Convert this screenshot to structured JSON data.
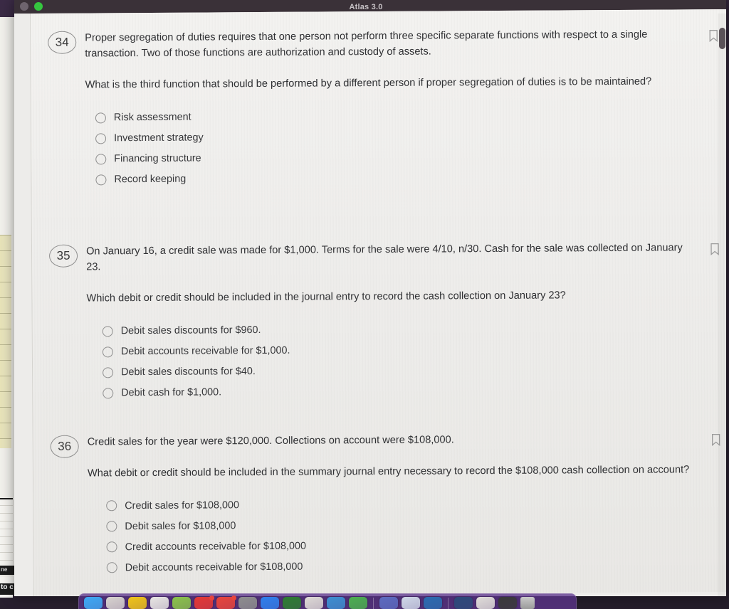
{
  "window": {
    "title": "Atlas 3.0",
    "traffic_lights": [
      "close-red",
      "minimize-gray",
      "zoom-green"
    ]
  },
  "icons": {
    "bookmark": "bookmark-icon",
    "radio": "radio-unselected-icon",
    "trash": "trash-icon"
  },
  "colors": {
    "titlebar": "#3a3138",
    "sheet": "#f0efed",
    "text": "#2f3033",
    "dock": "#5c348c",
    "close": "#e6463c",
    "minimize": "#6e646e",
    "zoom": "#35c63f"
  },
  "background_fragments": {
    "line1": "ne",
    "line2": "to c"
  },
  "questions": [
    {
      "number": "34",
      "stem": "Proper segregation of duties requires that one person not perform three specific separate functions with respect to a single transaction. Two of those functions are authorization and custody of assets.",
      "prompt": "What is the third function that should be performed by a different person if proper segregation of duties is to be maintained?",
      "bookmarked": false,
      "options": [
        "Risk assessment",
        "Investment strategy",
        "Financing structure",
        "Record keeping"
      ]
    },
    {
      "number": "35",
      "stem": "On January 16, a credit sale was made for $1,000. Terms for the sale were 4/10, n/30. Cash for the sale was collected on January 23.",
      "prompt": "Which debit or credit should be included in the journal entry to record the cash collection on January 23?",
      "bookmarked": false,
      "options": [
        "Debit sales discounts for $960.",
        "Debit accounts receivable for $1,000.",
        "Debit sales discounts for $40.",
        "Debit cash for $1,000."
      ]
    },
    {
      "number": "36",
      "stem": "Credit sales for the year were $120,000. Collections on account were $108,000.",
      "prompt": "What debit or credit should be included in the summary journal entry necessary to record the $108,000 cash collection on account?",
      "bookmarked": false,
      "options": [
        "Credit sales for $108,000",
        "Debit sales for $108,000",
        "Credit accounts receivable for $108,000",
        "Debit accounts receivable for $108,000"
      ]
    }
  ],
  "dock": {
    "items": [
      {
        "name": "finder",
        "color": "#3fa9f5"
      },
      {
        "name": "photos",
        "color": "#d8d3cf"
      },
      {
        "name": "notes",
        "color": "#f0c419"
      },
      {
        "name": "contacts",
        "color": "#e8e6e3"
      },
      {
        "name": "maps",
        "color": "#8bc34a"
      },
      {
        "name": "music",
        "color": "#e53935"
      },
      {
        "name": "news",
        "color": "#e8453c"
      },
      {
        "name": "podcasts",
        "color": "#8e8e8e"
      },
      {
        "name": "app-store",
        "color": "#2f80ed"
      },
      {
        "name": "browser",
        "color": "#2e7d32"
      },
      {
        "name": "facetime",
        "color": "#dedad6"
      },
      {
        "name": "safari",
        "color": "#3d8fd1"
      },
      {
        "name": "messages",
        "color": "#4caf50"
      },
      {
        "name": "calendar",
        "color": "#5c6bc0"
      },
      {
        "name": "preview",
        "color": "#cfd8e8"
      },
      {
        "name": "mail",
        "color": "#2b6cb0"
      },
      {
        "name": "terminal",
        "color": "#2d4a7a"
      },
      {
        "name": "downloads",
        "color": "#e0ddd9"
      },
      {
        "name": "documents",
        "color": "#3a3a3a"
      }
    ]
  }
}
